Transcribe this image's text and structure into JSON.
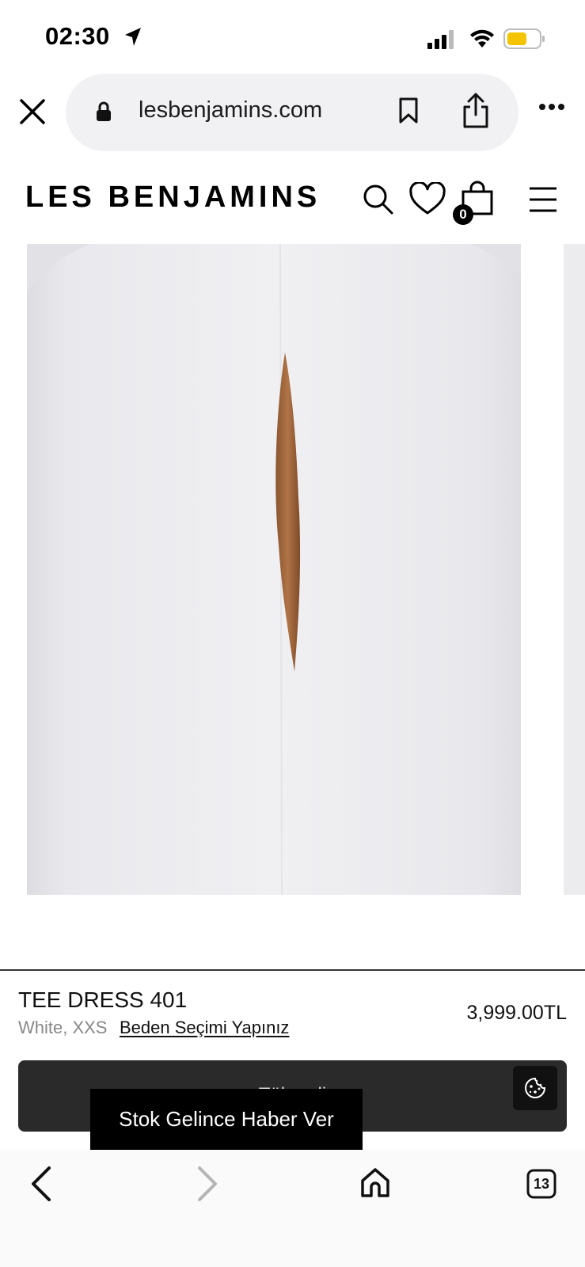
{
  "status_bar": {
    "time": "02:30"
  },
  "browser": {
    "url": "lesbenjamins.com",
    "tabs_count": "13"
  },
  "site": {
    "logo": "LES BENJAMINS",
    "cart_count": "0"
  },
  "product": {
    "name": "TEE DRESS 401",
    "variant": "White, XXS",
    "size_prompt": "Beden Seçimi Yapınız",
    "price": "3,999.00TL",
    "add_to_cart_label": "Tükendi",
    "notify_label": "Stok Gelince Haber Ver"
  },
  "colors": {
    "accent": "#000000",
    "cta_background": "#2a2a2a",
    "battery": "#f5c400"
  }
}
